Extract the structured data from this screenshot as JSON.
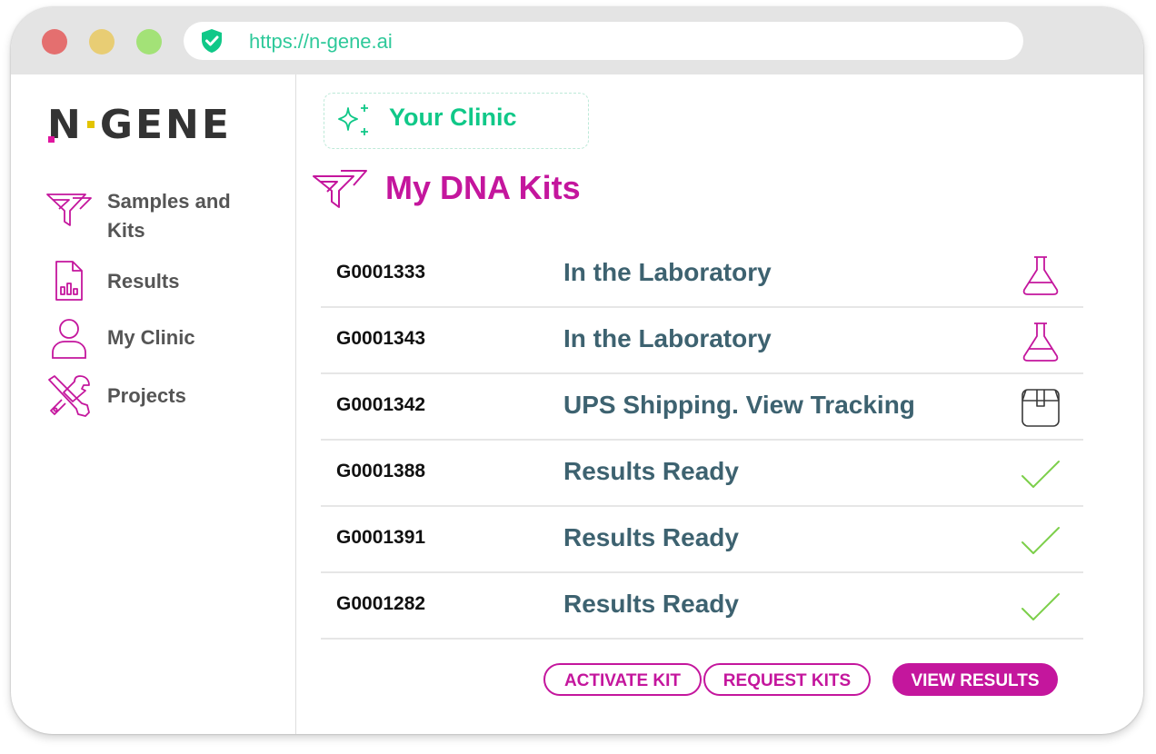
{
  "browser": {
    "url": "https://n-gene.ai",
    "secure_icon": "shield-check-icon"
  },
  "sidebar": {
    "logo": {
      "part1": "N",
      "part2": "GENE"
    },
    "items": [
      {
        "label": "Samples and Kits",
        "icon": "funnel-icon"
      },
      {
        "label": "Results",
        "icon": "report-icon"
      },
      {
        "label": "My Clinic",
        "icon": "user-icon"
      },
      {
        "label": "Projects",
        "icon": "tools-icon"
      }
    ]
  },
  "main": {
    "clinic_label": "Your Clinic",
    "title": "My DNA Kits",
    "kits": [
      {
        "id": "G0001333",
        "status": "In the Laboratory",
        "icon": "flask-icon"
      },
      {
        "id": "G0001343",
        "status": "In the Laboratory",
        "icon": "flask-icon"
      },
      {
        "id": "G0001342",
        "status": "UPS Shipping. View Tracking",
        "icon": "box-icon"
      },
      {
        "id": "G0001388",
        "status": "Results Ready",
        "icon": "checkmark-icon"
      },
      {
        "id": "G0001391",
        "status": "Results Ready",
        "icon": "checkmark-icon"
      },
      {
        "id": "G0001282",
        "status": "Results Ready",
        "icon": "checkmark-icon"
      }
    ],
    "buttons": {
      "activate": "ACTIVATE KIT",
      "request": "REQUEST KITS",
      "view": "VIEW RESULTS"
    }
  },
  "colors": {
    "brand_magenta": "#c4169d",
    "brand_green": "#10c888",
    "status_text": "#3d6270",
    "check_green": "#7ccf4a"
  }
}
